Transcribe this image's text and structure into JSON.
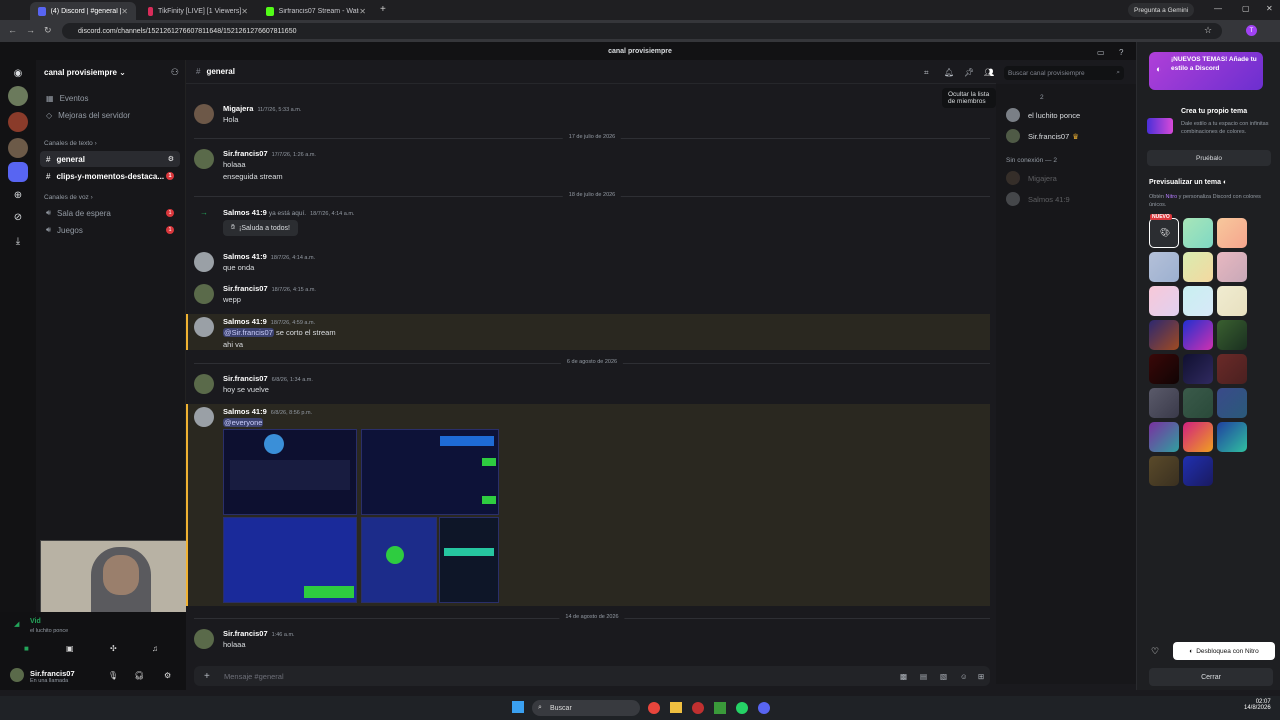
{
  "browser": {
    "tabs": [
      {
        "label": "(4) Discord | #general | can"
      },
      {
        "label": "TikFinity [LIVE] [1 Viewers]"
      },
      {
        "label": "Sirfrancis07 Stream - Watch Li"
      }
    ],
    "gemini": "Pregunta a Gemini",
    "url": "discord.com/channels/1521261276607811648/1521261276607811650"
  },
  "app": {
    "title": "canal provisiempre"
  },
  "guild": {
    "name": "canal provisiempre",
    "top_items": [
      "Eventos",
      "Mejoras del servidor"
    ],
    "text_category": "Canales de texto",
    "text_channels": [
      {
        "name": "general"
      },
      {
        "name": "clips-y-momentos-destaca..."
      }
    ],
    "voice_category": "Canales de voz",
    "voice_channels": [
      {
        "name": "Sala de espera"
      },
      {
        "name": "Juegos"
      }
    ]
  },
  "user_panel": {
    "voice_status": "Vid",
    "voice_sub": "el luchito ponce",
    "username": "Sir.francis07",
    "status": "En una llamada"
  },
  "channel": {
    "name": "general",
    "search_placeholder": "Buscar canal provisiempre",
    "tooltip": "Ocultar la lista de miembros",
    "composer_placeholder": "Mensaje #general"
  },
  "messages": [
    {
      "author": "Migajera",
      "time": "11/7/26, 5:33 a.m.",
      "lines": [
        "Hola"
      ]
    },
    {
      "divider": "17 de julio de 2026"
    },
    {
      "author": "Sir.francis07",
      "time": "17/7/26, 1:26 a.m.",
      "lines": [
        "holaaa",
        "enseguida stream"
      ]
    },
    {
      "divider": "18 de julio de 2026"
    },
    {
      "system": "Salmos 41:9",
      "system_text": "ya está aquí.",
      "time": "18/7/26, 4:14 a.m.",
      "button": "¡Saluda a todos!"
    },
    {
      "author": "Salmos 41:9",
      "time": "18/7/26, 4:14 a.m.",
      "lines": [
        "que onda"
      ]
    },
    {
      "author": "Sir.francis07",
      "time": "18/7/26, 4:15 a.m.",
      "lines": [
        "wepp"
      ]
    },
    {
      "author": "Salmos 41:9",
      "time": "18/7/26, 4:59 a.m.",
      "mention": "@Sir.francis07",
      "mention_rest": "se corto el stream",
      "lines": [
        "ahi va"
      ]
    },
    {
      "divider": "6 de agosto de 2026"
    },
    {
      "author": "Sir.francis07",
      "time": "6/8/26, 1:34 a.m.",
      "lines": [
        "hoy se vuelve"
      ]
    },
    {
      "author": "Salmos 41:9",
      "time": "6/8/26, 8:56 p.m.",
      "mention": "@everyone"
    },
    {
      "divider": "14 de agosto de 2026"
    },
    {
      "author": "Sir.francis07",
      "time": "1:46 a.m.",
      "lines": [
        "holaaa"
      ]
    }
  ],
  "members": {
    "online_count": "2",
    "online": [
      "el luchito ponce",
      "Sir.francis07"
    ],
    "offline_header": "Sin conexión — 2",
    "offline": [
      "Migajera",
      "Salmos 41:9"
    ]
  },
  "theme_panel": {
    "promo_title": "¡NUEVOS TEMAS! Añade tu estilo a Discord",
    "create_title": "Crea tu propio tema",
    "create_desc": "Dale estilo a tu espacio con infinitas combinaciones de colores.",
    "try_button": "Pruébalo",
    "preview_title": "Previsualizar un tema",
    "preview_desc_1": "Obtén ",
    "preview_nitro": "Nitro",
    "preview_desc_2": " y personaliza Discord con colores únicos.",
    "new_badge": "NUEVO",
    "unlock_button": "Desbloquea con Nitro",
    "close_button": "Cerrar",
    "accent": "#5865f2"
  },
  "taskbar": {
    "search": "Buscar",
    "time": "02:07",
    "date": "14/8/2026"
  }
}
